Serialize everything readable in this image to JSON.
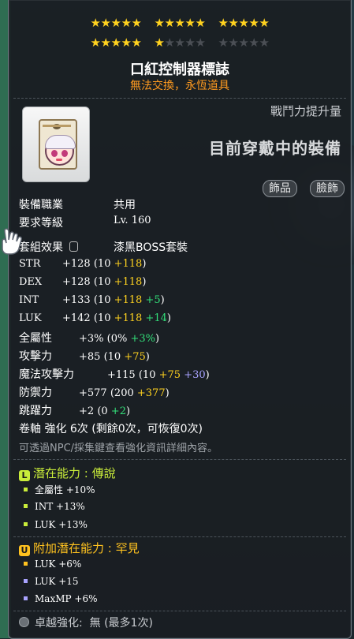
{
  "stars": {
    "row1_on": 15,
    "row2_on": 6,
    "total_per_row": 15
  },
  "item": {
    "name": "口紅控制器標誌",
    "flags": "無法交換，永恆道具"
  },
  "header": {
    "combat_power_label": "戰鬥力提升量",
    "equipped_label": "目前穿戴中的裝備"
  },
  "category_chips": [
    "飾品",
    "臉飾"
  ],
  "info": {
    "job_label": "裝備職業",
    "job_value": "共用",
    "level_label": "要求等級",
    "level_value": "Lv. 160",
    "set_label": "套組效果",
    "set_value": "漆黑BOSS套裝"
  },
  "stats": [
    {
      "name": "STR",
      "total": "+128",
      "base": "(10",
      "bonus": "+118",
      "extra": "",
      "close": ")"
    },
    {
      "name": "DEX",
      "total": "+128",
      "base": "(10",
      "bonus": "+118",
      "extra": "",
      "close": ")"
    },
    {
      "name": "INT",
      "total": "+133",
      "base": "(10",
      "bonus": "+118",
      "extra": "+5",
      "close": ")"
    },
    {
      "name": "LUK",
      "total": "+142",
      "base": "(10",
      "bonus": "+118",
      "extra": "+14",
      "close": ")"
    },
    {
      "name": "全屬性",
      "total": "+3%",
      "base": "(0%",
      "bonus": "",
      "extra": "+3%",
      "close": ")"
    },
    {
      "name": "攻擊力",
      "total": "+85",
      "base": "(10",
      "bonus": "+75",
      "extra": "",
      "close": ")"
    },
    {
      "name": "魔法攻擊力",
      "total": "+115",
      "base": "(10",
      "bonus": "+75",
      "extra": "+30",
      "close": ")"
    },
    {
      "name": "防禦力",
      "total": "+577",
      "base": "(200",
      "bonus": "+377",
      "extra": "",
      "close": ")"
    },
    {
      "name": "跳躍力",
      "total": "+2",
      "base": "(0",
      "bonus": "",
      "extra": "+2",
      "close": ")"
    }
  ],
  "scroll": {
    "text": "卷軸 強化 6次 (剩餘0次，可恢復0次)",
    "note": "可透過NPC/採集鍵查看強化資訊詳細內容。"
  },
  "potential": {
    "title": "潛在能力 : 傳說",
    "badge": "L",
    "lines": [
      "全屬性 +10%",
      "INT +13%",
      "LUK +13%"
    ]
  },
  "additional_potential": {
    "title": "附加潛在能力 : 罕見",
    "badge": "U",
    "lines": [
      "LUK +6%",
      "LUK +15",
      "MaxMP +6%"
    ]
  },
  "excellence": {
    "label": "卓越強化:",
    "value": "無 (最多1次)"
  },
  "colors": {
    "gold": "#ffd21f",
    "green": "#33e07a",
    "purple": "#a9a3ff",
    "orange": "#ff9a1f",
    "legendary": "#c9ec3a",
    "rare": "#ffc21f"
  }
}
